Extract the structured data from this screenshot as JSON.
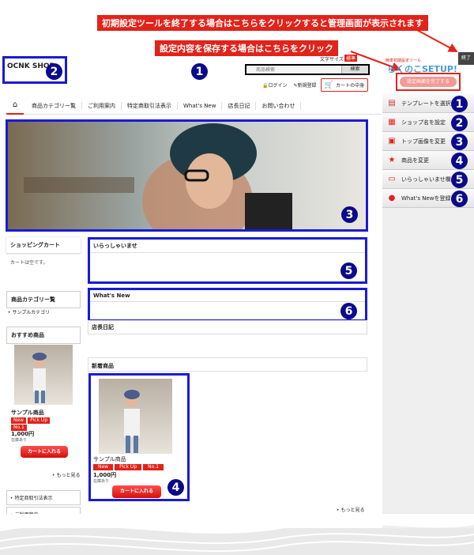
{
  "annotations": {
    "top_banner": "初期設定ツールを終了する場合はこちらをクリックすると管理画面が表示されます",
    "save_banner": "設定内容を保存する場合はこちらをクリック"
  },
  "numbers": [
    "1",
    "2",
    "3",
    "4",
    "5",
    "6"
  ],
  "shop": {
    "name": "OCNK SHOP",
    "font_size_label": "文字サイズ",
    "font_size_value": "標準",
    "search_placeholder": "商品検索",
    "search_button": "検索",
    "login": "ログイン",
    "register": "新規登録",
    "cart_button": "カートの中身"
  },
  "nav": {
    "home_icon": "home-icon",
    "items": [
      "商品カテゴリー覧",
      "ご利用案内",
      "特定商取引法表示",
      "What's New",
      "店長日記",
      "お問い合わせ"
    ]
  },
  "sidebar": {
    "cart_title": "ショッピングカート",
    "cart_empty": "カートは空です。",
    "category_title": "商品カテゴリー覧",
    "category_item": "サンプルカテゴリ",
    "recommend_title": "おすすめ商品",
    "product_name": "サンプル商品",
    "tags": [
      "New",
      "Pick Up",
      "No.1"
    ],
    "price": "1,000円",
    "stock": "在庫あり",
    "add_cart": "カートに入れる",
    "more": "もっと見る",
    "link1": "特定商取引法表示",
    "link2": "ご利用案内"
  },
  "main": {
    "welcome_title": "いらっしゃいませ",
    "whatsnew_title": "What's New",
    "diary_title": "店長日記",
    "new_title": "新着商品",
    "product_name": "サンプル商品",
    "tags": [
      "New",
      "Pick Up",
      "No.1"
    ],
    "price": "1,000円",
    "stock": "在庫あり",
    "add_cart": "カートに入れる",
    "more": "もっと見る"
  },
  "setup_panel": {
    "close": "終了",
    "logo_small": "簡単初期設定ツール",
    "logo_big": "らくのこSETUP!",
    "finish_button": "設定画面を完了する",
    "items": [
      {
        "icon": "template-icon",
        "label": "テンプレートを選択",
        "num": "1"
      },
      {
        "icon": "shop-name-icon",
        "label": "ショップ名を設定",
        "num": "2"
      },
      {
        "icon": "image-icon",
        "label": "トップ画像を変更",
        "num": "3"
      },
      {
        "icon": "star-icon",
        "label": "商品を変更",
        "num": "4"
      },
      {
        "icon": "welcome-icon",
        "label": "いらっしゃいませ欄",
        "num": "5"
      },
      {
        "icon": "speech-bubble-icon",
        "label": "What's Newを登録",
        "num": "6"
      }
    ]
  },
  "colors": {
    "accent": "#e2231a",
    "annotation_blue": "#1a1ad6",
    "number_badge": "#0a0a8c"
  }
}
